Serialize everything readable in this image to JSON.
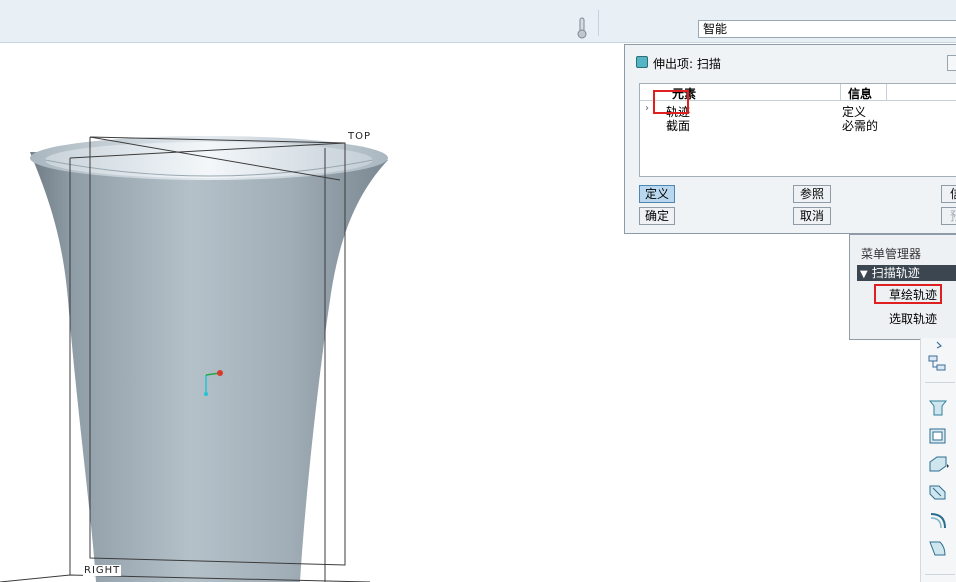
{
  "toolbar": {
    "filter_value": "智能"
  },
  "viewport": {
    "datum_top": "TOP",
    "datum_right": "RIGHT"
  },
  "dialog": {
    "title": "伸出项: 扫描",
    "columns": {
      "element": "元素",
      "info": "信息"
    },
    "rows": [
      {
        "element": "轨迹",
        "info": "定义"
      },
      {
        "element": "截面",
        "info": "必需的"
      }
    ],
    "buttons": {
      "define": "定义",
      "refs": "参照",
      "info": "信",
      "ok": "确定",
      "cancel": "取消",
      "preview": "预"
    }
  },
  "menu_manager": {
    "title": "菜单管理器",
    "section": "扫描轨迹",
    "items": [
      "草绘轨迹",
      "选取轨迹"
    ]
  },
  "colors": {
    "highlight": "#e02020",
    "model_surface": "#a7b4bd",
    "menu_header": "#3c4650"
  }
}
